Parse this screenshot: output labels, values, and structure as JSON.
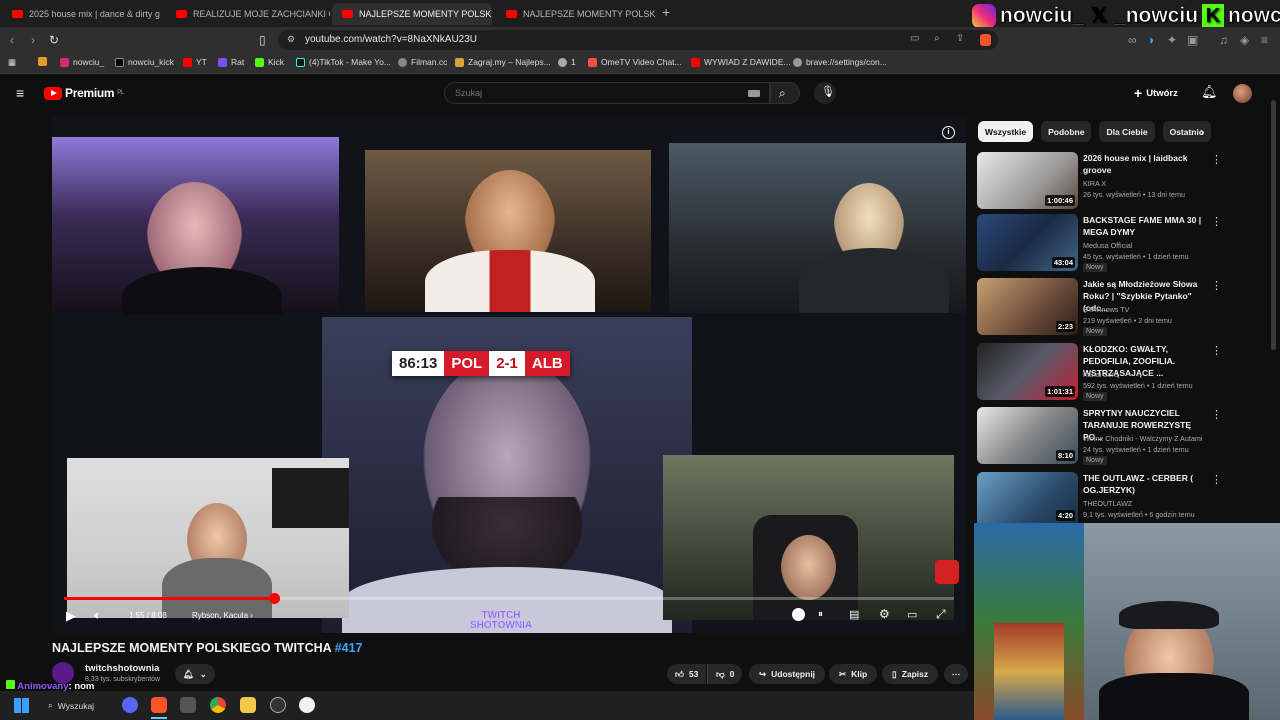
{
  "browser": {
    "tabs": [
      {
        "label": "2025 house mix | dance & dirty g"
      },
      {
        "label": "REALIZUJE MOJE ZACHCIANKI CIĄŻO"
      },
      {
        "label": "NAJLEPSZE MOMENTY POLSKIEG"
      },
      {
        "label": "NAJLEPSZE MOMENTY POLSKIEGO T"
      }
    ],
    "url": "youtube.com/watch?v=8NaXNkAU23U",
    "bookmarks": [
      {
        "label": "nowciu_"
      },
      {
        "label": "nowciu_kick"
      },
      {
        "label": "YT"
      },
      {
        "label": "Rat"
      },
      {
        "label": "Kick"
      },
      {
        "label": "(4)TikTok - Make Yo..."
      },
      {
        "label": "Filman.cc"
      },
      {
        "label": "Zagraj.my – Najleps..."
      },
      {
        "label": "1"
      },
      {
        "label": "OmeTV Video Chat..."
      },
      {
        "label": "WYWIAD Z DAWIDE..."
      },
      {
        "label": "brave://settings/con..."
      }
    ]
  },
  "overlay": {
    "names": [
      "nowciu_",
      "_nowciu",
      "nowciu"
    ]
  },
  "youtube": {
    "logo": "Premium",
    "region": "PL",
    "search_placeholder": "Szukaj",
    "create_label": "Utwórz"
  },
  "player": {
    "scoreboard": {
      "time": "86:13",
      "home": "POL",
      "score": "2-1",
      "away": "ALB"
    },
    "watermark": [
      "TWITCH",
      "SHOTOWNIA"
    ],
    "time": "1:55 / 8:08",
    "chapter": "Rybson, Kacula",
    "progress": 0.236
  },
  "video": {
    "title": "NAJLEPSZE MOMENTY POLSKIEGO TWITCHA",
    "title_tag": "#417",
    "channel": "twitchshotownia",
    "subscribers": "8,33 tys. subskrybentów",
    "likes": "53",
    "dislikes": "0",
    "share": "Udostępnij",
    "clip": "Klip",
    "save": "Zapisz"
  },
  "sidebar": {
    "chips": [
      "Wszystkie",
      "Podobne",
      "Dla Ciebie",
      "Ostatnio"
    ],
    "recommendations": [
      {
        "title": "2026 house mix | laidback groove",
        "channel": "KIRA X",
        "meta": "26 tys. wyświetleń • 13 dni temu",
        "duration": "1:00:46",
        "badge": ""
      },
      {
        "title": "BACKSTAGE FAME MMA 30 | MEGA DYMY",
        "channel": "Medusa Official",
        "meta": "45 tys. wyświetleń • 1 dzień temu",
        "duration": "43:04",
        "badge": "Nowy"
      },
      {
        "title": "Jakie są Młodzieżowe Słowa Roku? | \"Szybkie Pytanko\" (odc...",
        "channel": "STARnows TV",
        "meta": "219 wyświetleń • 2 dni temu",
        "duration": "2:23",
        "badge": "Nowy"
      },
      {
        "title": "KŁODZKO: GWAŁTY, PEDOFILIA, ZOOFILIA. WSTRZĄSAJĄCE ...",
        "channel": "Kanał Zero",
        "meta": "592 tys. wyświetleń • 1 dzień temu",
        "duration": "1:01:31",
        "badge": "Nowy"
      },
      {
        "title": "SPRYTNY NAUCZYCIEL TARANUJE ROWERZYSTĘ PO...",
        "channel": "Wolne Chodniki - Walczymy Z Autami",
        "meta": "24 tys. wyświetleń • 1 dzień temu",
        "duration": "8:10",
        "badge": "Nowy"
      },
      {
        "title": "THE OUTLAWZ - CERBER ( OG.JERZYK)",
        "channel": "THEOUTLAWZ",
        "meta": "9,1 tys. wyświetleń • 6 godzin temu",
        "duration": "4:20",
        "badge": ""
      }
    ]
  },
  "chat": {
    "user": "Animovany",
    "message": ": nom"
  },
  "taskbar": {
    "search": "Wyszukaj"
  },
  "colors": {
    "accent": "#ff0000",
    "link": "#3ea6ff",
    "bg": "#0f0f0f"
  }
}
